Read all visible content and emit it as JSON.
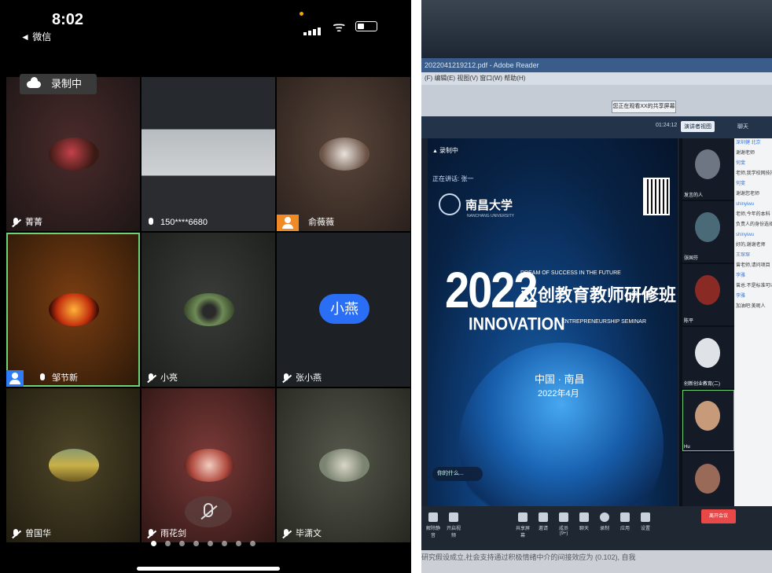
{
  "phone": {
    "status": {
      "time": "8:02",
      "back_label": "◄ 微信"
    },
    "recording_label": "录制中",
    "tiles": [
      {
        "name": "菁菁",
        "avatar_color": "#8b2b2b",
        "bg": "#2c2020"
      },
      {
        "name": "150****6680",
        "avatar_color": "",
        "bg": "#2b2d31"
      },
      {
        "name": "俞薇薇",
        "avatar_color": "#8c6a58",
        "bg": "#3a2c26"
      },
      {
        "name": "邹节新",
        "avatar_color": "#c8471a",
        "bg": "#2e1a0c"
      },
      {
        "name": "小亮",
        "avatar_color": "#4f6a3f",
        "bg": "#262826"
      },
      {
        "name": "张小燕",
        "avatar_color": "",
        "bg": "#1e2226",
        "bubble": "小燕"
      },
      {
        "name": "曾国华",
        "avatar_color": "#8f8a40",
        "bg": "#3a3420"
      },
      {
        "name": "雨花剑",
        "avatar_color": "#a84f48",
        "bg": "#4a2a2a"
      },
      {
        "name": "毕潇文",
        "avatar_color": "#7c8570",
        "bg": "#3a3a34"
      }
    ],
    "accent": "#2e7cf6",
    "active_border": "#6fd27a"
  },
  "laptop": {
    "titlebar": "2022041219212.pdf - Adobe Reader",
    "menubar": "(F)  编辑(E)  视图(V)  窗口(W)  帮助(H)",
    "toolbar_chip": "您正在观看XX的共享屏幕",
    "zoom": "01:24:12",
    "speaker_view": "演讲者视图",
    "chat_label": "聊天",
    "recording_mini": "录制中",
    "speaking": "正在讲话: 张一",
    "university": "南昌大学",
    "university_en": "NANCHANG UNIVERSITY",
    "year": "2022",
    "dream": "DREAM OF SUCCESS IN THE FUTURE",
    "cn_title": "双创教育教师研修班",
    "cn_sub": "(第一期)",
    "innovation": "INNOVATION",
    "entrepreneurship": "ENTREPRENEURSHIP SEMINAR",
    "place": "中国 · 南昌",
    "date": "2022年4月",
    "chip": "你的什么...",
    "thumb_labels": [
      "发言的人",
      "张国芬",
      "陈平",
      "创新创业教育(二)",
      "Hu",
      ""
    ],
    "chat_lines": [
      {
        "u": "深圳健 北京",
        "t": "谢谢老师"
      },
      {
        "u": "何斐",
        "t": "老师,我学校网技持"
      },
      {
        "u": "何斐",
        "t": "谢谢您老师"
      },
      {
        "u": "shinyiwu",
        "t": "老师,今年的本科"
      },
      {
        "u": "",
        "t": "负责人的身份选择"
      },
      {
        "u": "shinyiwu",
        "t": "好的,谢谢老师"
      },
      {
        "u": "王琛琛",
        "t": "曾老师,请问项目"
      },
      {
        "u": "李雅",
        "t": "曾总:不是标准可以"
      },
      {
        "u": "李雅",
        "t": "加油吧:美呢人"
      }
    ],
    "bottom_items": [
      "解除静音",
      "开启视频",
      "共享屏幕",
      "邀请",
      "成员(9+)",
      "聊天",
      "录制",
      "应用",
      "设置"
    ],
    "end_label": "离开会议",
    "paper_line": "研究假设成立,社会支持通过积极情绪中介的间接效应为 (0.102), 自我"
  }
}
